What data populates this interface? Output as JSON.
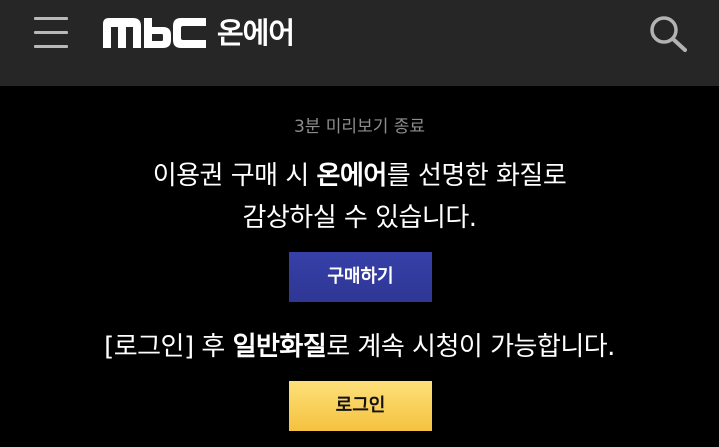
{
  "header": {
    "brand_logo": "MBC",
    "service_name": "온에어"
  },
  "icons": {
    "menu": "hamburger-menu-icon",
    "search": "search-icon"
  },
  "main": {
    "preview_end": "3분 미리보기 종료",
    "purchase_line1_pre": "이용권 구매 시 ",
    "purchase_line1_bold": "온에어",
    "purchase_line1_post": "를 선명한 화질로",
    "purchase_line2": "감상하실 수 있습니다.",
    "buy_button": "구매하기",
    "login_line_pre": "[로그인] 후 ",
    "login_line_bold": "일반화질",
    "login_line_post": "로 계속 시청이 가능합니다.",
    "login_button": "로그인"
  },
  "colors": {
    "header_bg": "#262626",
    "page_bg": "#000000",
    "buy_button_bg": "#3640a8",
    "login_button_bg": "#f8cf56",
    "muted_text": "#8d8d8d"
  }
}
